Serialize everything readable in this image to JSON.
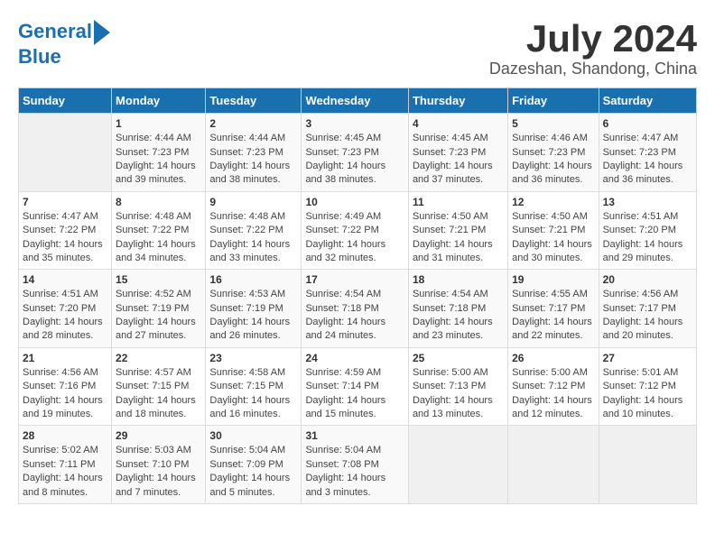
{
  "header": {
    "logo_line1": "General",
    "logo_line2": "Blue",
    "title": "July 2024",
    "subtitle": "Dazeshan, Shandong, China"
  },
  "weekdays": [
    "Sunday",
    "Monday",
    "Tuesday",
    "Wednesday",
    "Thursday",
    "Friday",
    "Saturday"
  ],
  "weeks": [
    [
      {
        "day": "",
        "empty": true
      },
      {
        "day": "1",
        "sunrise": "Sunrise: 4:44 AM",
        "sunset": "Sunset: 7:23 PM",
        "daylight": "Daylight: 14 hours and 39 minutes."
      },
      {
        "day": "2",
        "sunrise": "Sunrise: 4:44 AM",
        "sunset": "Sunset: 7:23 PM",
        "daylight": "Daylight: 14 hours and 38 minutes."
      },
      {
        "day": "3",
        "sunrise": "Sunrise: 4:45 AM",
        "sunset": "Sunset: 7:23 PM",
        "daylight": "Daylight: 14 hours and 38 minutes."
      },
      {
        "day": "4",
        "sunrise": "Sunrise: 4:45 AM",
        "sunset": "Sunset: 7:23 PM",
        "daylight": "Daylight: 14 hours and 37 minutes."
      },
      {
        "day": "5",
        "sunrise": "Sunrise: 4:46 AM",
        "sunset": "Sunset: 7:23 PM",
        "daylight": "Daylight: 14 hours and 36 minutes."
      },
      {
        "day": "6",
        "sunrise": "Sunrise: 4:47 AM",
        "sunset": "Sunset: 7:23 PM",
        "daylight": "Daylight: 14 hours and 36 minutes."
      }
    ],
    [
      {
        "day": "7",
        "sunrise": "Sunrise: 4:47 AM",
        "sunset": "Sunset: 7:22 PM",
        "daylight": "Daylight: 14 hours and 35 minutes."
      },
      {
        "day": "8",
        "sunrise": "Sunrise: 4:48 AM",
        "sunset": "Sunset: 7:22 PM",
        "daylight": "Daylight: 14 hours and 34 minutes."
      },
      {
        "day": "9",
        "sunrise": "Sunrise: 4:48 AM",
        "sunset": "Sunset: 7:22 PM",
        "daylight": "Daylight: 14 hours and 33 minutes."
      },
      {
        "day": "10",
        "sunrise": "Sunrise: 4:49 AM",
        "sunset": "Sunset: 7:22 PM",
        "daylight": "Daylight: 14 hours and 32 minutes."
      },
      {
        "day": "11",
        "sunrise": "Sunrise: 4:50 AM",
        "sunset": "Sunset: 7:21 PM",
        "daylight": "Daylight: 14 hours and 31 minutes."
      },
      {
        "day": "12",
        "sunrise": "Sunrise: 4:50 AM",
        "sunset": "Sunset: 7:21 PM",
        "daylight": "Daylight: 14 hours and 30 minutes."
      },
      {
        "day": "13",
        "sunrise": "Sunrise: 4:51 AM",
        "sunset": "Sunset: 7:20 PM",
        "daylight": "Daylight: 14 hours and 29 minutes."
      }
    ],
    [
      {
        "day": "14",
        "sunrise": "Sunrise: 4:51 AM",
        "sunset": "Sunset: 7:20 PM",
        "daylight": "Daylight: 14 hours and 28 minutes."
      },
      {
        "day": "15",
        "sunrise": "Sunrise: 4:52 AM",
        "sunset": "Sunset: 7:19 PM",
        "daylight": "Daylight: 14 hours and 27 minutes."
      },
      {
        "day": "16",
        "sunrise": "Sunrise: 4:53 AM",
        "sunset": "Sunset: 7:19 PM",
        "daylight": "Daylight: 14 hours and 26 minutes."
      },
      {
        "day": "17",
        "sunrise": "Sunrise: 4:54 AM",
        "sunset": "Sunset: 7:18 PM",
        "daylight": "Daylight: 14 hours and 24 minutes."
      },
      {
        "day": "18",
        "sunrise": "Sunrise: 4:54 AM",
        "sunset": "Sunset: 7:18 PM",
        "daylight": "Daylight: 14 hours and 23 minutes."
      },
      {
        "day": "19",
        "sunrise": "Sunrise: 4:55 AM",
        "sunset": "Sunset: 7:17 PM",
        "daylight": "Daylight: 14 hours and 22 minutes."
      },
      {
        "day": "20",
        "sunrise": "Sunrise: 4:56 AM",
        "sunset": "Sunset: 7:17 PM",
        "daylight": "Daylight: 14 hours and 20 minutes."
      }
    ],
    [
      {
        "day": "21",
        "sunrise": "Sunrise: 4:56 AM",
        "sunset": "Sunset: 7:16 PM",
        "daylight": "Daylight: 14 hours and 19 minutes."
      },
      {
        "day": "22",
        "sunrise": "Sunrise: 4:57 AM",
        "sunset": "Sunset: 7:15 PM",
        "daylight": "Daylight: 14 hours and 18 minutes."
      },
      {
        "day": "23",
        "sunrise": "Sunrise: 4:58 AM",
        "sunset": "Sunset: 7:15 PM",
        "daylight": "Daylight: 14 hours and 16 minutes."
      },
      {
        "day": "24",
        "sunrise": "Sunrise: 4:59 AM",
        "sunset": "Sunset: 7:14 PM",
        "daylight": "Daylight: 14 hours and 15 minutes."
      },
      {
        "day": "25",
        "sunrise": "Sunrise: 5:00 AM",
        "sunset": "Sunset: 7:13 PM",
        "daylight": "Daylight: 14 hours and 13 minutes."
      },
      {
        "day": "26",
        "sunrise": "Sunrise: 5:00 AM",
        "sunset": "Sunset: 7:12 PM",
        "daylight": "Daylight: 14 hours and 12 minutes."
      },
      {
        "day": "27",
        "sunrise": "Sunrise: 5:01 AM",
        "sunset": "Sunset: 7:12 PM",
        "daylight": "Daylight: 14 hours and 10 minutes."
      }
    ],
    [
      {
        "day": "28",
        "sunrise": "Sunrise: 5:02 AM",
        "sunset": "Sunset: 7:11 PM",
        "daylight": "Daylight: 14 hours and 8 minutes."
      },
      {
        "day": "29",
        "sunrise": "Sunrise: 5:03 AM",
        "sunset": "Sunset: 7:10 PM",
        "daylight": "Daylight: 14 hours and 7 minutes."
      },
      {
        "day": "30",
        "sunrise": "Sunrise: 5:04 AM",
        "sunset": "Sunset: 7:09 PM",
        "daylight": "Daylight: 14 hours and 5 minutes."
      },
      {
        "day": "31",
        "sunrise": "Sunrise: 5:04 AM",
        "sunset": "Sunset: 7:08 PM",
        "daylight": "Daylight: 14 hours and 3 minutes."
      },
      {
        "day": "",
        "empty": true
      },
      {
        "day": "",
        "empty": true
      },
      {
        "day": "",
        "empty": true
      }
    ]
  ]
}
